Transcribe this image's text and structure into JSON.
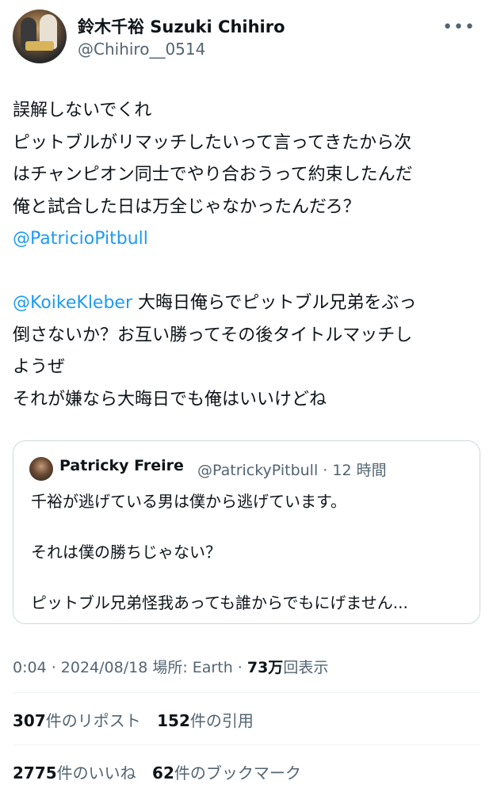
{
  "author": {
    "display_name": "鈴木千裕 Suzuki Chihiro",
    "handle": "@Chihiro__0514"
  },
  "tweet": {
    "lines": [
      {
        "text": "誤解しないでくれ"
      },
      {
        "text": "ピットブルがリマッチしたいって言ってきたから次"
      },
      {
        "text": "はチャンピオン同士でやり合おうって約束したんだ"
      },
      {
        "text": "俺と試合した日は万全じゃなかったんだろ？"
      },
      {
        "mention": "@PatricioPitbull"
      },
      {
        "text": ""
      },
      {
        "mention": "@KoikeKleber",
        "text": " 大晦日俺らでピットブル兄弟をぶっ"
      },
      {
        "text": "倒さないか？お互い勝ってその後タイトルマッチし"
      },
      {
        "text": "ようぜ"
      },
      {
        "text": "それが嫌なら大晦日でも俺はいいけどね"
      }
    ]
  },
  "quote": {
    "name": "Patricky Freire",
    "handle_time": "@PatrickyPitbull · 12 時間",
    "lines": [
      "千裕が逃げている男は僕から逃げています。",
      "",
      "それは僕の勝ちじゃない？",
      "",
      "ピットブル兄弟怪我あっても誰からでもにげません..."
    ]
  },
  "meta": {
    "time_date": "0:04 · 2024/08/18 ",
    "place": "場所: Earth · ",
    "views_num": "73万",
    "views_label": "回表示"
  },
  "stats": {
    "reposts_num": "307",
    "reposts_label": "件のリポスト",
    "quotes_num": "152",
    "quotes_label": "件の引用",
    "likes_num": "2775",
    "likes_label": "件のいいね",
    "bookmarks_num": "62",
    "bookmarks_label": "件のブックマーク"
  },
  "icons": {
    "more": "more-horizontal-icon"
  }
}
